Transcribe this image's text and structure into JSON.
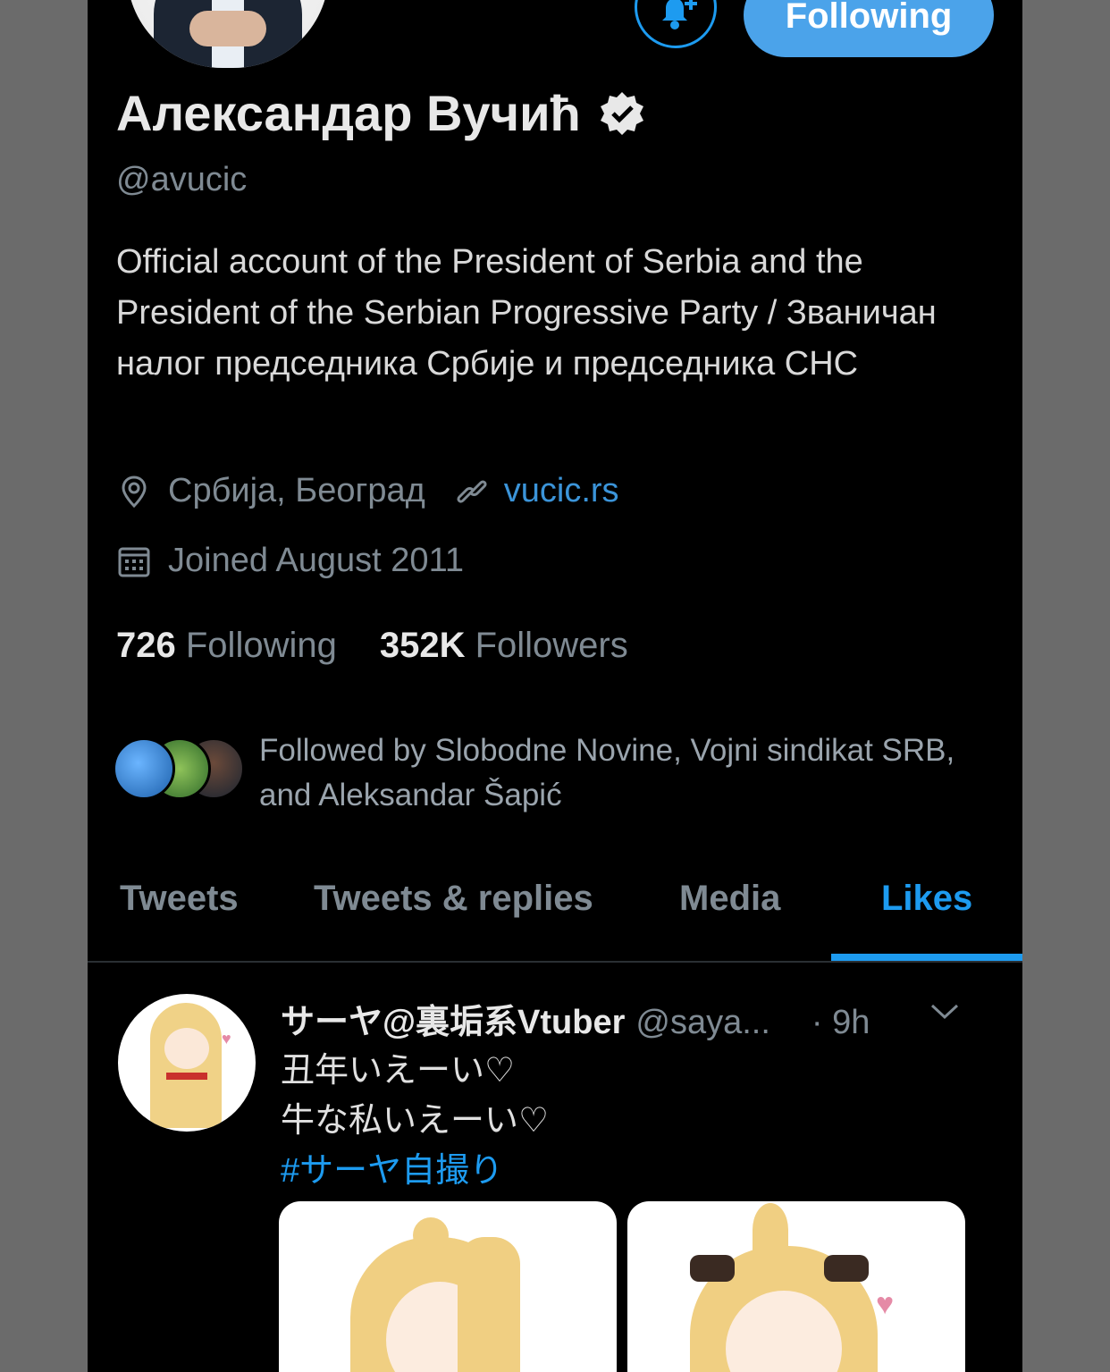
{
  "profile": {
    "name": "Александар Вучић",
    "handle": "@avucic",
    "bio": "Official account of the President of Serbia and the President of the Serbian Progressive Party / Званичан налог председника Србије и председника СНС",
    "location": "Србија, Београд",
    "website": "vucic.rs",
    "joined": "Joined August 2011",
    "following_count": "726",
    "following_label": "Following",
    "followers_count": "352K",
    "followers_label": "Followers",
    "followed_by": "Followed by Slobodne Novine, Vojni sindikat SRB, and Aleksandar Šapić",
    "follow_button_label": "Following"
  },
  "tabs": [
    {
      "label": "Tweets"
    },
    {
      "label": "Tweets & replies"
    },
    {
      "label": "Media"
    },
    {
      "label": "Likes"
    }
  ],
  "active_tab": "Likes",
  "tweet": {
    "author_name": "サーヤ@裏垢系Vtuber",
    "author_handle": "@saya...",
    "time": "· 9h",
    "line1": "丑年いえーい♡",
    "line2": "牛な私いえーい♡",
    "hashtag": "#サーヤ自撮り"
  },
  "icons": {
    "notify": "bell-plus-icon",
    "verified": "verified-badge-icon",
    "location": "location-pin-icon",
    "link": "link-icon",
    "calendar": "calendar-icon",
    "caret": "chevron-down-icon"
  },
  "colors": {
    "accent": "#1d9bf0",
    "background": "#000000",
    "muted": "#7f8a93"
  }
}
